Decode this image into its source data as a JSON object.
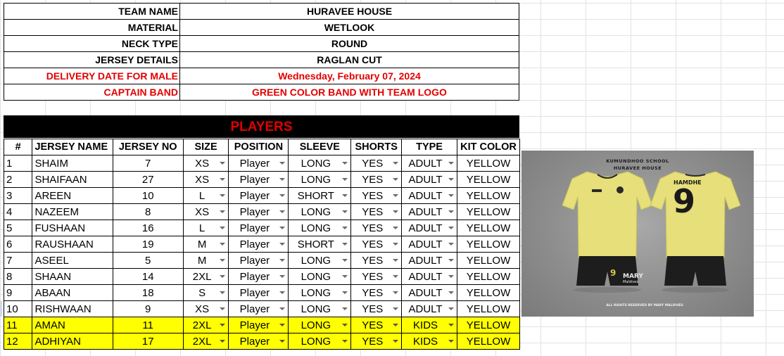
{
  "info": [
    {
      "label": "TEAM NAME",
      "value": "HURAVEE HOUSE",
      "highlight": false
    },
    {
      "label": "MATERIAL",
      "value": "WETLOOK",
      "highlight": false
    },
    {
      "label": "NECK TYPE",
      "value": "ROUND",
      "highlight": false
    },
    {
      "label": "JERSEY DETAILS",
      "value": "RAGLAN CUT",
      "highlight": false
    },
    {
      "label": "DELIVERY DATE FOR MALE",
      "value": "Wednesday, February 07, 2024",
      "highlight": true
    },
    {
      "label": "CAPTAIN BAND",
      "value": "GREEN COLOR BAND WITH TEAM LOGO",
      "highlight": true
    }
  ],
  "players_title": "PLAYERS",
  "headers": {
    "num": "#",
    "jersey_name": "JERSEY NAME",
    "jersey_no": "JERSEY NO",
    "size": "SIZE",
    "position": "POSITION",
    "sleeve": "SLEEVE",
    "shorts": "SHORTS",
    "type": "TYPE",
    "kit_color": "KIT COLOR"
  },
  "players": [
    {
      "num": "1",
      "name": "SHAIM",
      "no": "7",
      "size": "XS",
      "position": "Player",
      "sleeve": "LONG",
      "shorts": "YES",
      "type": "ADULT",
      "kit": "YELLOW",
      "highlight": false
    },
    {
      "num": "2",
      "name": "SHAIFAAN",
      "no": "27",
      "size": "XS",
      "position": "Player",
      "sleeve": "LONG",
      "shorts": "YES",
      "type": "ADULT",
      "kit": "YELLOW",
      "highlight": false
    },
    {
      "num": "3",
      "name": "AREEN",
      "no": "10",
      "size": "L",
      "position": "Player",
      "sleeve": "SHORT",
      "shorts": "YES",
      "type": "ADULT",
      "kit": "YELLOW",
      "highlight": false
    },
    {
      "num": "4",
      "name": "NAZEEM",
      "no": "8",
      "size": "XS",
      "position": "Player",
      "sleeve": "LONG",
      "shorts": "YES",
      "type": "ADULT",
      "kit": "YELLOW",
      "highlight": false
    },
    {
      "num": "5",
      "name": "FUSHAAN",
      "no": "16",
      "size": "L",
      "position": "Player",
      "sleeve": "LONG",
      "shorts": "YES",
      "type": "ADULT",
      "kit": "YELLOW",
      "highlight": false
    },
    {
      "num": "6",
      "name": "RAUSHAAN",
      "no": "19",
      "size": "M",
      "position": "Player",
      "sleeve": "SHORT",
      "shorts": "YES",
      "type": "ADULT",
      "kit": "YELLOW",
      "highlight": false
    },
    {
      "num": "7",
      "name": "ASEEL",
      "no": "5",
      "size": "M",
      "position": "Player",
      "sleeve": "LONG",
      "shorts": "YES",
      "type": "ADULT",
      "kit": "YELLOW",
      "highlight": false
    },
    {
      "num": "8",
      "name": "SHAAN",
      "no": "14",
      "size": "2XL",
      "position": "Player",
      "sleeve": "LONG",
      "shorts": "YES",
      "type": "ADULT",
      "kit": "YELLOW",
      "highlight": false
    },
    {
      "num": "9",
      "name": "ABAAN",
      "no": "18",
      "size": "S",
      "position": "Player",
      "sleeve": "LONG",
      "shorts": "YES",
      "type": "ADULT",
      "kit": "YELLOW",
      "highlight": false
    },
    {
      "num": "10",
      "name": "RISHWAAN",
      "no": "9",
      "size": "XS",
      "position": "Player",
      "sleeve": "LONG",
      "shorts": "YES",
      "type": "ADULT",
      "kit": "YELLOW",
      "highlight": false
    },
    {
      "num": "11",
      "name": "AMAN",
      "no": "11",
      "size": "2XL",
      "position": "Player",
      "sleeve": "LONG",
      "shorts": "YES",
      "type": "KIDS",
      "kit": "YELLOW",
      "highlight": true
    },
    {
      "num": "12",
      "name": "ADHIYAN",
      "no": "17",
      "size": "2XL",
      "position": "Player",
      "sleeve": "LONG",
      "shorts": "YES",
      "type": "KIDS",
      "kit": "YELLOW",
      "highlight": true
    }
  ],
  "jersey_image": {
    "caption_line1": "KUMUNDHOO SCHOOL",
    "caption_line2": "HURAVEE HOUSE",
    "back_name": "HAMDHE",
    "back_number": "9",
    "shorts_number": "9",
    "brand": "MARY",
    "brand_sub": "Maldives",
    "rights": "ALL RIGHTS RESERVED BY MARY MALDIVES"
  },
  "colors": {
    "red_text": "#e30000",
    "kids_row": "#ffff00",
    "header_band": "#000000",
    "kit_yellow": "#e6df7a"
  }
}
